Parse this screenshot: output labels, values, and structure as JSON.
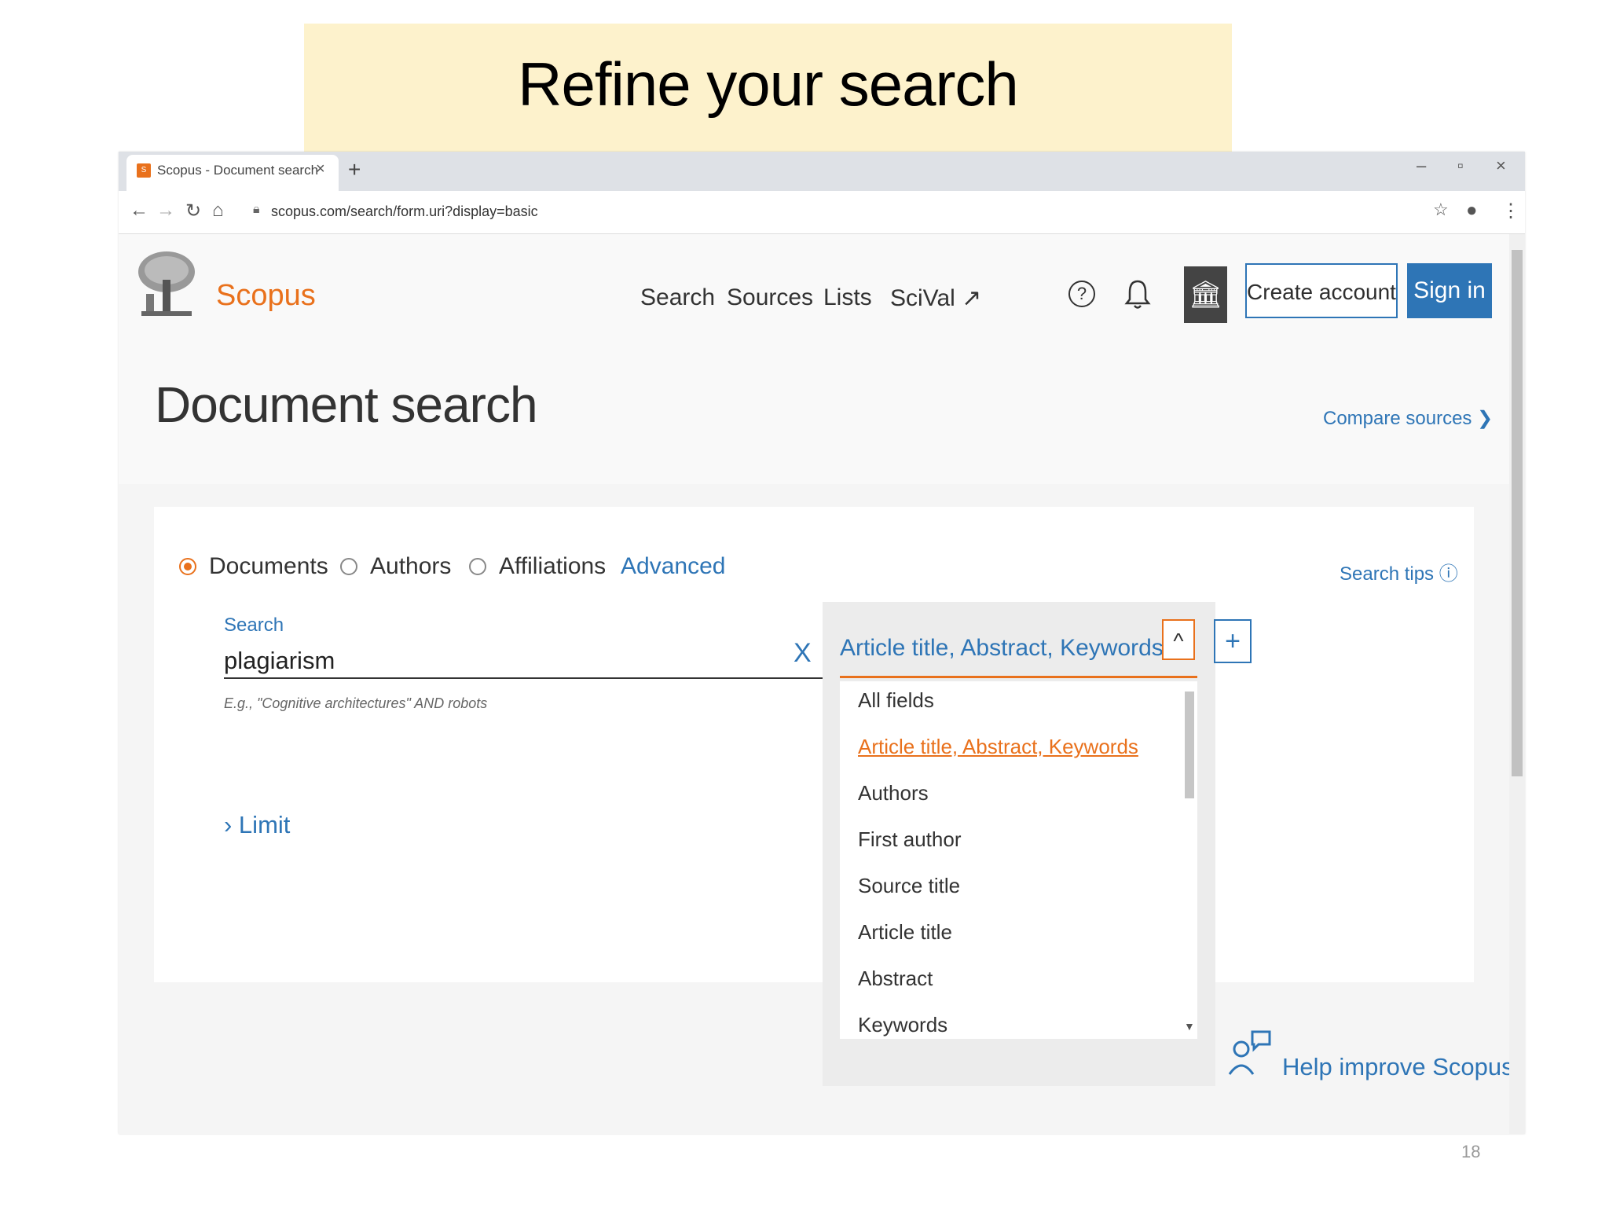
{
  "slide": {
    "title": "Refine your search",
    "page_number": "18"
  },
  "browser": {
    "tab_title": "Scopus - Document search",
    "url": "scopus.com/search/form.uri?display=basic",
    "tab_close": "×",
    "new_tab": "+",
    "window_controls": [
      "–",
      "▫",
      "×"
    ]
  },
  "header": {
    "logo_text": "Scopus",
    "nav": [
      {
        "label": "Search"
      },
      {
        "label": "Sources"
      },
      {
        "label": "Lists"
      },
      {
        "label": "SciVal ↗"
      }
    ],
    "create_account": "Create account",
    "sign_in": "Sign in"
  },
  "main": {
    "page_title": "Document search",
    "compare_sources": "Compare sources ❯",
    "search_types": [
      {
        "label": "Documents",
        "selected": true
      },
      {
        "label": "Authors",
        "selected": false
      },
      {
        "label": "Affiliations",
        "selected": false
      }
    ],
    "advanced": "Advanced",
    "search_tips": "Search tips ⓘ",
    "search": {
      "label": "Search",
      "value": "plagiarism",
      "clear": "X",
      "example": "E.g., \"Cognitive architectures\" AND robots"
    },
    "limit": "› Limit",
    "field_select": {
      "selected": "Article title, Abstract, Keywords",
      "caret": "^",
      "add": "+",
      "options": [
        "All fields",
        "Article title, Abstract, Keywords",
        "Authors",
        "First author",
        "Source title",
        "Article title",
        "Abstract",
        "Keywords"
      ]
    },
    "help_improve": "Help improve Scopus"
  },
  "colors": {
    "accent": "#e9711c",
    "link": "#2e75b6",
    "banner": "#fdf2cc"
  }
}
